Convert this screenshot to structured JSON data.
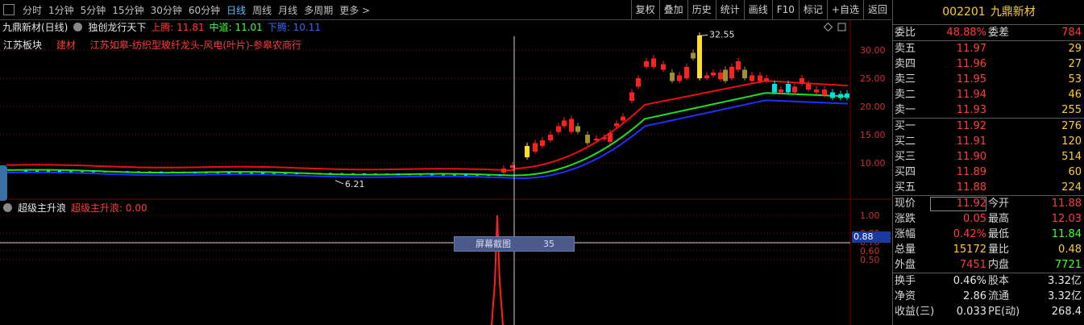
{
  "toolbar": {
    "periods": [
      "分时",
      "1分钟",
      "5分钟",
      "15分钟",
      "30分钟",
      "60分钟",
      "日线",
      "周线",
      "月线",
      "多周期",
      "更多 >"
    ],
    "active_period": "日线",
    "buttons": [
      "复权",
      "叠加",
      "历史",
      "统计",
      "画线",
      "F10",
      "标记",
      "+自选",
      "返回"
    ]
  },
  "chart": {
    "stock_title": "九鼎新材(日线)",
    "indicator_name": "独创龙行天下",
    "upper_label": "上腾: 11.81",
    "middle_label": "中道: 11.01",
    "lower_label": "下腾: 10.11",
    "block_tags": [
      "江苏板块",
      "建材",
      "江苏如皋-纺织型玻纤龙头-风电(叶片)-参皋农商行"
    ],
    "high_label": "32.55",
    "low_label": "6.21",
    "price_axis": [
      "30.00",
      "25.00",
      "20.00",
      "15.00",
      "10.00"
    ],
    "colors": {
      "up": "#ff2020",
      "down": "#00e0e0",
      "upper": "#e81010",
      "middle": "#20e020",
      "lower": "#2030ff",
      "olive": "#a09030",
      "yellow": "#ffe020"
    }
  },
  "sub_chart": {
    "name": "超级主升浪",
    "value_label": "超级主升浪: 0.00",
    "axis": [
      "1.00",
      "0.80",
      "0.70",
      "0.60",
      "0.50"
    ],
    "cursor_value": "0.88",
    "tooltip_text": "屏幕截图",
    "tooltip_num": "35"
  },
  "quote": {
    "code": "002201",
    "name": "九鼎新材",
    "weibi_label": "委比",
    "weibi": "48.88%",
    "weicha_label": "委差",
    "weicha": "784",
    "asks": [
      {
        "label": "卖五",
        "price": "11.97",
        "vol": "29"
      },
      {
        "label": "卖四",
        "price": "11.96",
        "vol": "27"
      },
      {
        "label": "卖三",
        "price": "11.95",
        "vol": "53"
      },
      {
        "label": "卖二",
        "price": "11.94",
        "vol": "46"
      },
      {
        "label": "卖一",
        "price": "11.93",
        "vol": "255"
      }
    ],
    "bids": [
      {
        "label": "买一",
        "price": "11.92",
        "vol": "276"
      },
      {
        "label": "买二",
        "price": "11.91",
        "vol": "120"
      },
      {
        "label": "买三",
        "price": "11.90",
        "vol": "514"
      },
      {
        "label": "买四",
        "price": "11.89",
        "vol": "60"
      },
      {
        "label": "买五",
        "price": "11.88",
        "vol": "224"
      }
    ],
    "stats": [
      {
        "l1": "现价",
        "v1": "11.92",
        "c1": "red",
        "l2": "今开",
        "v2": "11.88",
        "c2": "red"
      },
      {
        "l1": "涨跌",
        "v1": "0.05",
        "c1": "red",
        "l2": "最高",
        "v2": "12.03",
        "c2": "red"
      },
      {
        "l1": "涨幅",
        "v1": "0.42%",
        "c1": "red",
        "l2": "最低",
        "v2": "11.84",
        "c2": "green"
      },
      {
        "l1": "总量",
        "v1": "15172",
        "c1": "yellow",
        "l2": "量比",
        "v2": "0.48",
        "c2": "yellow"
      },
      {
        "l1": "外盘",
        "v1": "7451",
        "c1": "red",
        "l2": "内盘",
        "v2": "7721",
        "c2": "green"
      }
    ],
    "extra": [
      {
        "l1": "换手",
        "v1": "0.46%",
        "l2": "股本",
        "v2": "3.32亿"
      },
      {
        "l1": "净资",
        "v1": "2.86",
        "l2": "流通",
        "v2": "3.32亿"
      },
      {
        "l1": "收益(三)",
        "v1": "0.033",
        "l2": "PE(动)",
        "v2": "268.4"
      }
    ]
  }
}
